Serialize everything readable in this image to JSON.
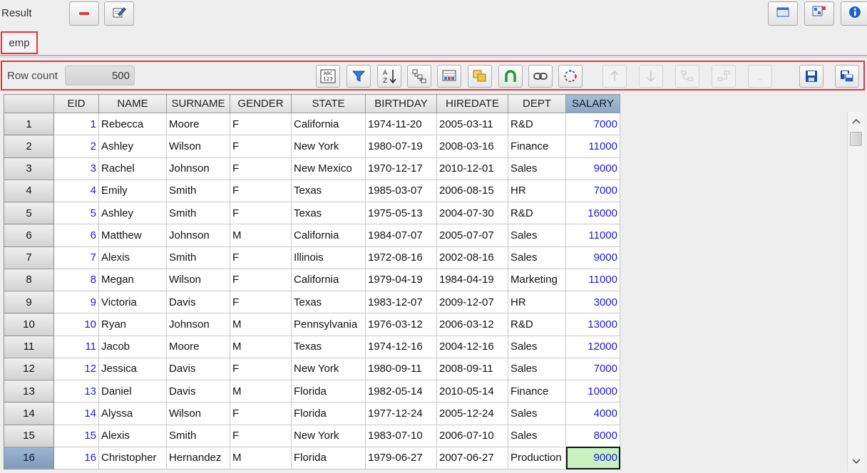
{
  "header": {
    "result_label": "Result"
  },
  "tab": {
    "label": "emp"
  },
  "toolbar": {
    "row_count_label": "Row count",
    "row_count_value": "500"
  },
  "table": {
    "columns": [
      "EID",
      "NAME",
      "SURNAME",
      "GENDER",
      "STATE",
      "BIRTHDAY",
      "HIREDATE",
      "DEPT",
      "SALARY"
    ],
    "selected_column": "SALARY",
    "rows": [
      [
        "1",
        "1",
        "Rebecca",
        "Moore",
        "F",
        "California",
        "1974-11-20",
        "2005-03-11",
        "R&D",
        "7000"
      ],
      [
        "2",
        "2",
        "Ashley",
        "Wilson",
        "F",
        "New York",
        "1980-07-19",
        "2008-03-16",
        "Finance",
        "11000"
      ],
      [
        "3",
        "3",
        "Rachel",
        "Johnson",
        "F",
        "New Mexico",
        "1970-12-17",
        "2010-12-01",
        "Sales",
        "9000"
      ],
      [
        "4",
        "4",
        "Emily",
        "Smith",
        "F",
        "Texas",
        "1985-03-07",
        "2006-08-15",
        "HR",
        "7000"
      ],
      [
        "5",
        "5",
        "Ashley",
        "Smith",
        "F",
        "Texas",
        "1975-05-13",
        "2004-07-30",
        "R&D",
        "16000"
      ],
      [
        "6",
        "6",
        "Matthew",
        "Johnson",
        "M",
        "California",
        "1984-07-07",
        "2005-07-07",
        "Sales",
        "11000"
      ],
      [
        "7",
        "7",
        "Alexis",
        "Smith",
        "F",
        "Illinois",
        "1972-08-16",
        "2002-08-16",
        "Sales",
        "9000"
      ],
      [
        "8",
        "8",
        "Megan",
        "Wilson",
        "F",
        "California",
        "1979-04-19",
        "1984-04-19",
        "Marketing",
        "11000"
      ],
      [
        "9",
        "9",
        "Victoria",
        "Davis",
        "F",
        "Texas",
        "1983-12-07",
        "2009-12-07",
        "HR",
        "3000"
      ],
      [
        "10",
        "10",
        "Ryan",
        "Johnson",
        "M",
        "Pennsylvania",
        "1976-03-12",
        "2006-03-12",
        "R&D",
        "13000"
      ],
      [
        "11",
        "11",
        "Jacob",
        "Moore",
        "M",
        "Texas",
        "1974-12-16",
        "2004-12-16",
        "Sales",
        "12000"
      ],
      [
        "12",
        "12",
        "Jessica",
        "Davis",
        "F",
        "New York",
        "1980-09-11",
        "2008-09-11",
        "Sales",
        "7000"
      ],
      [
        "13",
        "13",
        "Daniel",
        "Davis",
        "M",
        "Florida",
        "1982-05-14",
        "2010-05-14",
        "Finance",
        "10000"
      ],
      [
        "14",
        "14",
        "Alyssa",
        "Wilson",
        "F",
        "Florida",
        "1977-12-24",
        "2005-12-24",
        "Sales",
        "4000"
      ],
      [
        "15",
        "15",
        "Alexis",
        "Smith",
        "F",
        "New York",
        "1983-07-10",
        "2006-07-10",
        "Sales",
        "8000"
      ],
      [
        "16",
        "16",
        "Christopher",
        "Hernandez",
        "M",
        "Florida",
        "1979-06-27",
        "2007-06-27",
        "Production",
        "9000"
      ]
    ],
    "active_row": 16
  },
  "icons": {
    "top_left": [
      "delete-row-icon",
      "edit-icon"
    ],
    "top_right": [
      "window-icon",
      "layout-icon",
      "info-icon"
    ],
    "toolbar": [
      "abc123-format-icon",
      "filter-icon",
      "sort-az-icon",
      "tree-icon",
      "grid-color-icon",
      "copy-icon",
      "intersection-icon",
      "link-icon",
      "refresh-circle-icon",
      "move-up-icon",
      "move-down-icon",
      "indent-icon",
      "outdent-icon",
      "blank-icon",
      "save-icon",
      "save-as-icon"
    ]
  },
  "colors": {
    "accent_red": "#e8343a",
    "number_blue": "#1a1ad6",
    "selected_header": "#8da6c3",
    "current_cell": "#c8f2c0"
  }
}
